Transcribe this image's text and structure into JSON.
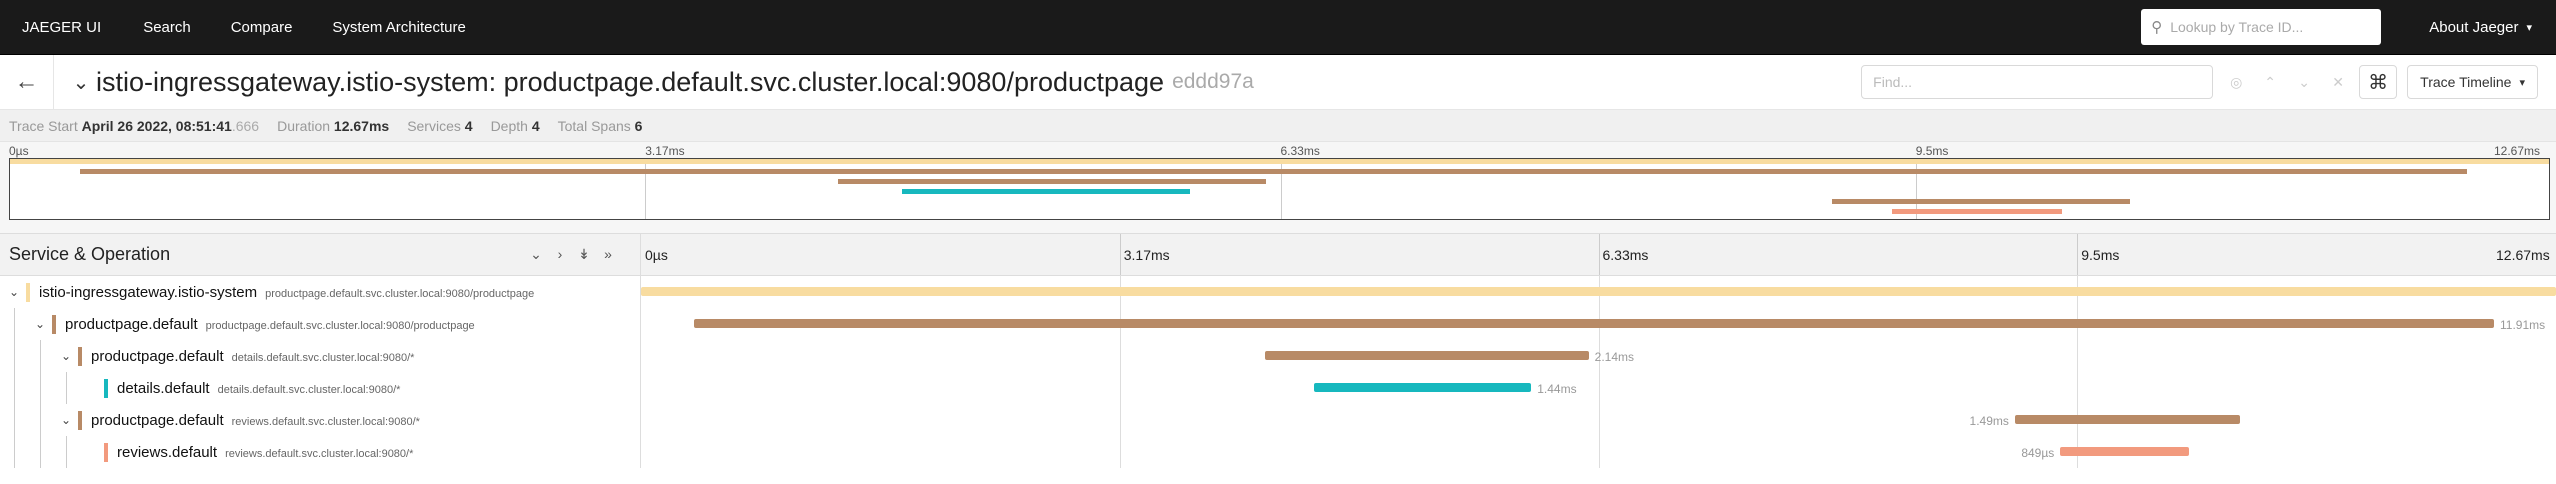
{
  "nav": {
    "brand": "JAEGER UI",
    "links": [
      "Search",
      "Compare",
      "System Architecture"
    ],
    "lookup_placeholder": "Lookup by Trace ID...",
    "about": "About Jaeger"
  },
  "trace": {
    "title": "istio-ingressgateway.istio-system: productpage.default.svc.cluster.local:9080/productpage",
    "trace_id": "eddd97a",
    "find_placeholder": "Find...",
    "view": "Trace Timeline"
  },
  "summary": {
    "start_label": "Trace Start",
    "start_value": "April 26 2022, 08:51:41",
    "start_frac": ".666",
    "duration_label": "Duration",
    "duration_value": "12.67ms",
    "services_label": "Services",
    "services_value": "4",
    "depth_label": "Depth",
    "depth_value": "4",
    "spans_label": "Total Spans",
    "spans_value": "6"
  },
  "ticks": [
    "0µs",
    "3.17ms",
    "6.33ms",
    "9.5ms",
    "12.67ms"
  ],
  "columns": {
    "service_operation": "Service & Operation"
  },
  "colors": {
    "istio-ingressgateway.istio-system": "#f8dca0",
    "productpage.default": "#b88a66",
    "details.default": "#17b8be",
    "reviews.default": "#f29a7e"
  },
  "spans": [
    {
      "service": "istio-ingressgateway.istio-system",
      "operation": "productpage.default.svc.cluster.local:9080/productpage",
      "depth": 0,
      "start_ms": 0.0,
      "dur_ms": 12.67,
      "label": "",
      "label_side": "right",
      "collapsible": true
    },
    {
      "service": "productpage.default",
      "operation": "productpage.default.svc.cluster.local:9080/productpage",
      "depth": 1,
      "start_ms": 0.35,
      "dur_ms": 11.91,
      "label": "11.91ms",
      "label_side": "right",
      "collapsible": true
    },
    {
      "service": "productpage.default",
      "operation": "details.default.svc.cluster.local:9080/*",
      "depth": 2,
      "start_ms": 4.13,
      "dur_ms": 2.14,
      "label": "2.14ms",
      "label_side": "right",
      "collapsible": true
    },
    {
      "service": "details.default",
      "operation": "details.default.svc.cluster.local:9080/*",
      "depth": 3,
      "start_ms": 4.45,
      "dur_ms": 1.44,
      "label": "1.44ms",
      "label_side": "right",
      "collapsible": false
    },
    {
      "service": "productpage.default",
      "operation": "reviews.default.svc.cluster.local:9080/*",
      "depth": 2,
      "start_ms": 9.09,
      "dur_ms": 1.49,
      "label": "1.49ms",
      "label_side": "left",
      "collapsible": true
    },
    {
      "service": "reviews.default",
      "operation": "reviews.default.svc.cluster.local:9080/*",
      "depth": 3,
      "start_ms": 9.39,
      "dur_ms": 0.849,
      "label": "849µs",
      "label_side": "left",
      "collapsible": false
    }
  ],
  "total_ms": 12.67
}
